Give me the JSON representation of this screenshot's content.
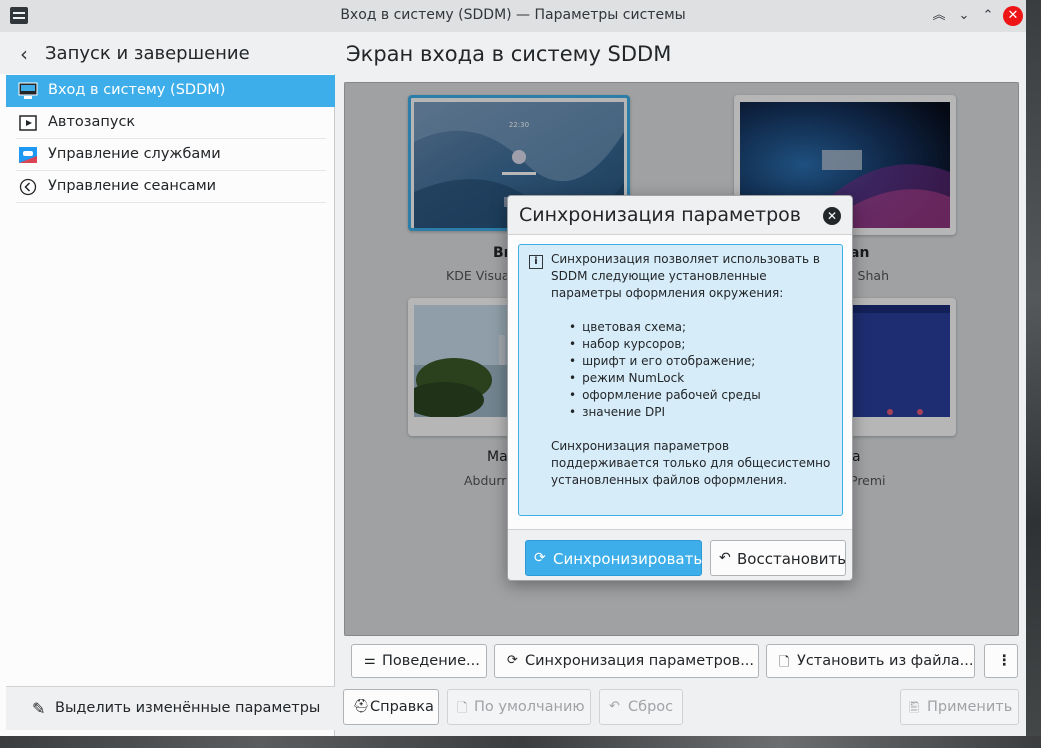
{
  "window": {
    "title": "Вход в систему (SDDM) — Параметры системы"
  },
  "sidebar": {
    "header": "Запуск и завершение",
    "items": [
      {
        "label": "Вход в систему (SDDM)"
      },
      {
        "label": "Автозапуск"
      },
      {
        "label": "Управление службами"
      },
      {
        "label": "Управление сеансами"
      }
    ],
    "footer": "Выделить изменённые параметры"
  },
  "main": {
    "title": "Экран входа в систему SDDM",
    "themes": [
      {
        "name": "Br",
        "author": "KDE Visual"
      },
      {
        "name": "an",
        "author": "ah Shah"
      },
      {
        "name": "Ma",
        "author": "Abdurra"
      },
      {
        "name": "a",
        "author": "Premi"
      }
    ],
    "preview_time": "22:30"
  },
  "toolbar": {
    "behavior": "Поведение...",
    "sync": "Синхронизация параметров...",
    "install": "Установить из файла...",
    "more": "⋮"
  },
  "footer": {
    "help": "Справка",
    "defaults": "По умолчанию",
    "reset": "Сброс",
    "apply": "Применить"
  },
  "dialog": {
    "title": "Синхронизация параметров",
    "intro": "Синхронизация позволяет использовать в SDDM следующие установленные параметры оформления окружения:",
    "items": [
      "цветовая схема;",
      "набор курсоров;",
      "шрифт и его отображение;",
      "режим NumLock",
      "оформление рабочей среды",
      "значение DPI"
    ],
    "note": "Синхронизация параметров поддерживается только для общесистемно установленных файлов оформления.",
    "sync_button": "Синхронизировать",
    "restore_button": "Восстановить"
  },
  "colors": {
    "accent": "#3daee9",
    "close": "#ed1515"
  }
}
